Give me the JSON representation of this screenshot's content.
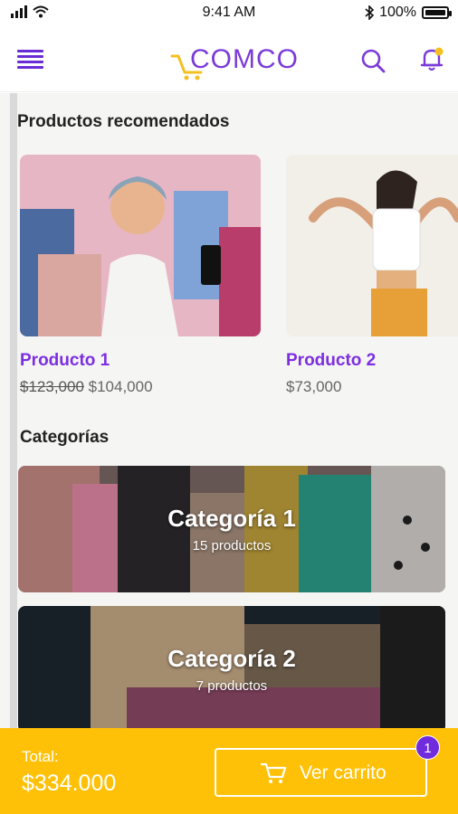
{
  "status_bar": {
    "time": "9:41 AM",
    "battery": "100%"
  },
  "header": {
    "logo_text": "COMCO",
    "icons": [
      "menu-icon",
      "search-icon",
      "bell-icon"
    ],
    "accent": "#7a3ad9"
  },
  "recommended": {
    "title": "Productos recomendados",
    "products": [
      {
        "name": "Producto 1",
        "old_price": "$123,000",
        "price": "$104,000"
      },
      {
        "name": "Producto 2",
        "price": "$73,000"
      }
    ]
  },
  "categories": {
    "title": "Categorías",
    "items": [
      {
        "name": "Categoría 1",
        "count": "15 productos"
      },
      {
        "name": "Categoría 2",
        "count": "7 productos"
      }
    ]
  },
  "footer": {
    "total_label": "Total:",
    "total_value": "$334.000",
    "cart_button": "Ver carrito",
    "cart_badge": "1",
    "bar_color": "#ffc107",
    "badge_color": "#6f2bdc"
  }
}
